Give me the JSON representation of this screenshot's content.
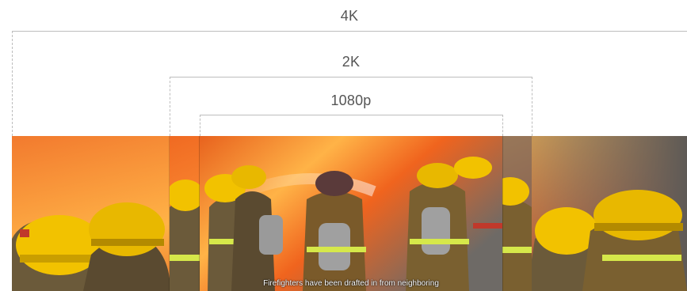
{
  "labels": {
    "res_4k": "4K",
    "res_2k": "2K",
    "res_1080p": "1080p"
  },
  "caption": "Firefighters have been drafted in from neighboring",
  "colors": {
    "guide_line": "#bdbdbd",
    "label_text": "#555555",
    "fire_bright": "#ffb347",
    "fire_orange": "#f0641e",
    "smoke": "#6e6a66",
    "helmet_yellow": "#f2c200",
    "coat_tan": "#8a6a32",
    "reflective_stripe": "#d6e84a"
  }
}
